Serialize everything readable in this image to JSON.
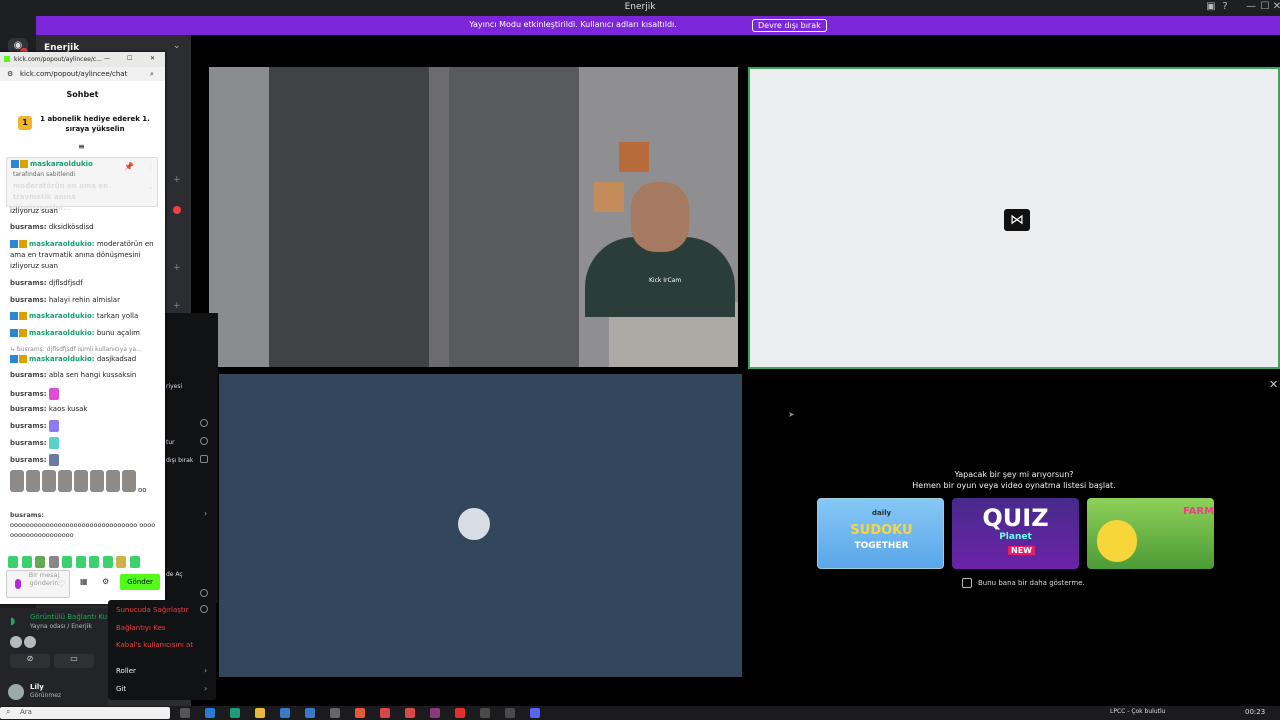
{
  "window": {
    "title": "Enerjik",
    "controls": [
      "—",
      "☐",
      "✕"
    ]
  },
  "banner": {
    "text": "Yayıncı Modu etkinleştirildi. Kullanıcı adları kısaltıldı.",
    "button": "Devre dışı bırak"
  },
  "server": {
    "name": "Enerjik"
  },
  "chat_window": {
    "url_short": "kick.com/popout/aylincee/c...",
    "url": "kick.com/popout/aylincee/chat",
    "title": "Sohbet",
    "gift_text": "1 abonelik hediye ederek 1. sıraya yükselin",
    "pinned": {
      "user": "maskaraoldukio",
      "sub": "tarafından sabitlendi",
      "message": "moderatörün en ama en travmatik anına dönüşmesini..."
    },
    "messages": [
      {
        "user": "",
        "text": "izliyoruz suan"
      },
      {
        "user": "busrams:",
        "text": "dksidkösdisd"
      },
      {
        "user": "maskaraoldukio:",
        "text": "moderatörün en ama en travmatik anına dönüşmesini izliyoruz suan"
      },
      {
        "user": "busrams:",
        "text": "djflsdfjsdf"
      },
      {
        "user": "busrams:",
        "text": "halayi rehin almislar"
      },
      {
        "user": "maskaraoldukio:",
        "text": "tarkan yolla"
      },
      {
        "user": "maskaraoldukio:",
        "text": "bunu açalım"
      },
      {
        "user": "",
        "text": "↳ busrams: djflsdfjsdf isimli kullanıcıya ya..."
      },
      {
        "user": "maskaraoldukio:",
        "text": "dasjkadsad"
      },
      {
        "user": "busrams:",
        "text": "abla sen hangi kussaksin"
      },
      {
        "user": "busrams:",
        "text": ""
      },
      {
        "user": "busrams:",
        "text": "kaos kusak"
      },
      {
        "user": "busrams:",
        "text": ""
      },
      {
        "user": "busrams:",
        "text": ""
      },
      {
        "user": "busrams:",
        "text": ""
      },
      {
        "user": "busrams:",
        "text": "oooooooooooooooooooooooooooooooo oooooooooooooooooooo"
      }
    ],
    "emote_suffix": "oo",
    "input_placeholder": "Bir mesaj gönderin",
    "send_label": "Gönder"
  },
  "context_menu": {
    "items": [
      {
        "label": "Sunucuda Sağırlaştır",
        "danger": true
      },
      {
        "label": "Bağlantıyı Kes",
        "danger": true
      },
      {
        "label": "Kabal's kullanıcısını at",
        "danger": true
      },
      {
        "label": "Roller",
        "danger": false
      },
      {
        "label": "Git",
        "danger": false
      }
    ],
    "behind_labels": [
      "riyesi",
      "tur",
      "dışı bırak",
      "de Aç"
    ]
  },
  "voice": {
    "status": "Görüntülü Bağlantı Ku",
    "channel": "Yayna odası / Enerjik"
  },
  "user": {
    "name": "Lily",
    "status": "Görünmez"
  },
  "stream": {
    "camera_label": "Kick IrCam"
  },
  "activity": {
    "question": "Yapacak bir şey mi arıyorsun?",
    "subtitle": "Hemen bir oyun veya video oynatma listesi başlat.",
    "games": [
      {
        "name": "Daily Sudoku Together",
        "label_top": "daily",
        "label_main": "SUDOKU",
        "label_bottom": "TOGETHER"
      },
      {
        "name": "Quiz Planet",
        "label_main": "QUIZ",
        "label_sub": "Planet",
        "label_badge": "NEW"
      },
      {
        "name": "Farm Merge Valley",
        "label_main": "FARM"
      }
    ],
    "dont_show": "Bunu bana bir daha gösterme."
  },
  "taskbar": {
    "search": "Ara",
    "clock": "00:23",
    "tray_text": "LPCC - Çok bulutlu"
  }
}
